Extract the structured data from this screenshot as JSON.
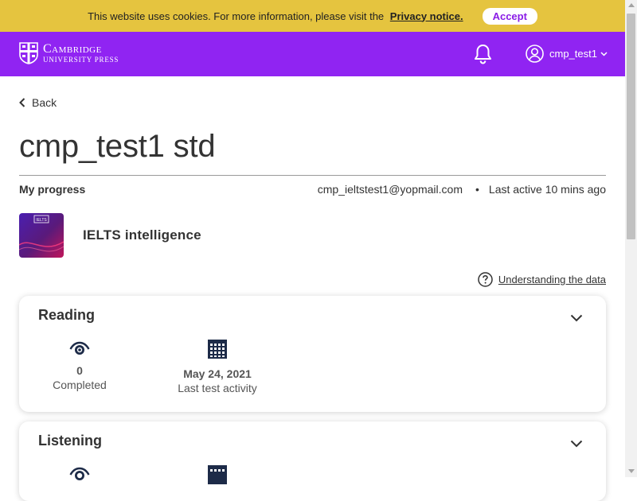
{
  "cookie": {
    "message": "This website uses cookies. For more information, please visit the",
    "link_text": "Privacy notice.",
    "accept_label": "Accept"
  },
  "header": {
    "logo_line1": "Cambridge",
    "logo_line2": "University Press",
    "username": "cmp_test1",
    "brand_color": "#9024f2"
  },
  "nav": {
    "back_label": "Back"
  },
  "page": {
    "title": "cmp_test1 std",
    "progress_label": "My progress",
    "email": "cmp_ieltstest1@yopmail.com",
    "separator": "•",
    "last_active": "Last active 10 mins ago"
  },
  "course": {
    "title": "IELTS intelligence",
    "thumb_text": "IELTS"
  },
  "help": {
    "understanding_label": "Understanding the data"
  },
  "sections": [
    {
      "title": "Reading",
      "completed_value": "0",
      "completed_label": "Completed",
      "activity_value": "May 24, 2021",
      "activity_label": "Last test activity"
    },
    {
      "title": "Listening"
    }
  ],
  "icons": {
    "bell": "bell-icon",
    "user": "user-circle-icon",
    "chevron": "chevron-down-icon",
    "back": "chevron-left-icon",
    "help": "question-circle-icon",
    "eye": "eye-icon",
    "calendar": "calendar-icon"
  }
}
